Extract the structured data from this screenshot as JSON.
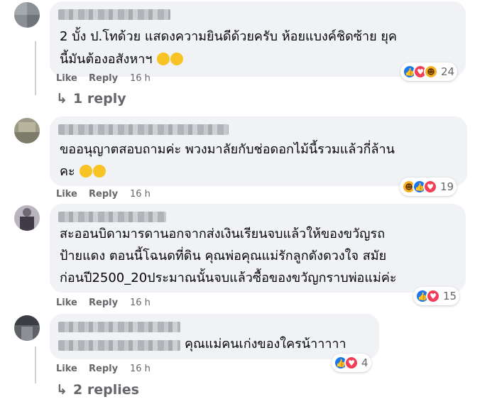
{
  "colors": {
    "bubble": "#f0f2f5",
    "meta": "#65676b",
    "like": "#1877f2",
    "love": "#f33e58",
    "haha": "#f7b125"
  },
  "comments": [
    {
      "line1": "2 บั้ง ป.โทด้วย แสดงความยินดีด้วยครับ ห้อยแบงค์ชิดซ้าย ยุค",
      "line2": "นี้มันต้องอสังหาฯ",
      "emoji": [
        "rofl-emoji",
        "rofl-emoji"
      ],
      "like": "Like",
      "reply": "Reply",
      "time": "16 h",
      "reactions": [
        "like-icon",
        "love-icon",
        "haha-icon"
      ],
      "reaction_count": "24",
      "replies_label": "1 reply"
    },
    {
      "line1": "ขออนุญาตสอบถามค่ะ พวงมาลัยกับช่อดอกไม้นี้รวมแล้วกี่ล้าน",
      "line2": "คะ",
      "emoji": [
        "joy-emoji",
        "joy-emoji"
      ],
      "like": "Like",
      "reply": "Reply",
      "time": "16 h",
      "reactions": [
        "haha-icon",
        "like-icon",
        "love-icon"
      ],
      "reaction_count": "19"
    },
    {
      "line1": "สะออนบิดามารดานอกจากส่งเงินเรียนจบแล้วให้ของขวัญรถ",
      "line2": "ป้ายแดง ตอนนี้โฉนดที่ดิน คุณพ่อคุณแม่รักลูกดังดวงใจ สมัย",
      "line3": "ก่อนปี2500_20ประมาณนั้นจบแล้วซื้อของขวัญกราบพ่อแม่ค่ะ",
      "like": "Like",
      "reply": "Reply",
      "time": "16 h",
      "reactions": [
        "like-icon",
        "love-icon"
      ],
      "reaction_count": "15"
    },
    {
      "line1": "คุณแม่คนเก่งของใครน้าาาาา",
      "like": "Like",
      "reply": "Reply",
      "time": "16 h",
      "reactions": [
        "like-icon",
        "love-icon"
      ],
      "reaction_count": "4",
      "replies_label": "2 replies"
    }
  ]
}
